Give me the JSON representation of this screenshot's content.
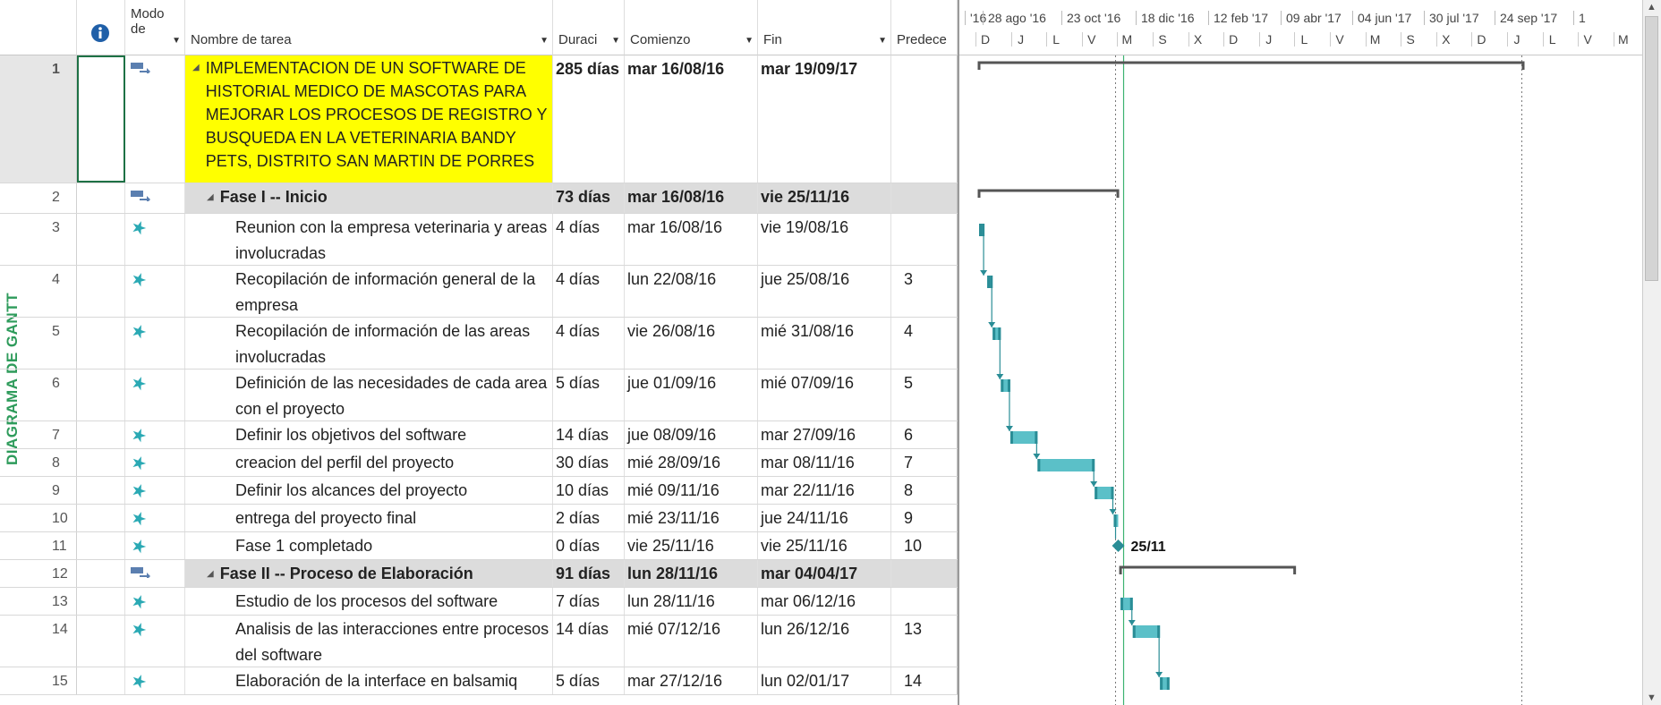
{
  "side_label": "DIAGRAMA DE GANTT",
  "headers": {
    "info_icon": "info-icon",
    "mode": "Modo de",
    "name": "Nombre de tarea",
    "duration": "Duraci",
    "start": "Comienzo",
    "end": "Fin",
    "pred": "Predece"
  },
  "timescale": {
    "top": [
      "'16",
      "28 ago '16",
      "23 oct '16",
      "18 dic '16",
      "12 feb '17",
      "09 abr '17",
      "04 jun '17",
      "30 jul '17",
      "24 sep '17",
      "1"
    ],
    "bottom": [
      "D",
      "J",
      "L",
      "V",
      "M",
      "S",
      "X",
      "D",
      "J",
      "L",
      "V",
      "M",
      "S",
      "X",
      "D",
      "J",
      "L",
      "V",
      "M"
    ]
  },
  "rows": [
    {
      "num": "1",
      "mode": "summary",
      "name": "IMPLEMENTACION DE UN SOFTWARE DE HISTORIAL MEDICO DE MASCOTAS PARA MEJORAR LOS PROCESOS DE REGISTRO Y BUSQUEDA EN LA VETERINARIA BANDY PETS, DISTRITO SAN MARTIN DE PORRES",
      "duration": "285 días",
      "start": "mar 16/08/16",
      "end": "mar 19/09/17",
      "pred": ""
    },
    {
      "num": "2",
      "mode": "summary",
      "name": "Fase I -- Inicio",
      "duration": "73 días",
      "start": "mar 16/08/16",
      "end": "vie 25/11/16",
      "pred": ""
    },
    {
      "num": "3",
      "mode": "manual",
      "name": "Reunion con la empresa veterinaria y areas involucradas",
      "duration": "4 días",
      "start": "mar 16/08/16",
      "end": "vie 19/08/16",
      "pred": ""
    },
    {
      "num": "4",
      "mode": "manual",
      "name": "Recopilación de información general de la empresa",
      "duration": "4 días",
      "start": "lun 22/08/16",
      "end": "jue 25/08/16",
      "pred": "3"
    },
    {
      "num": "5",
      "mode": "manual",
      "name": "Recopilación de información de las areas involucradas",
      "duration": "4 días",
      "start": "vie 26/08/16",
      "end": "mié 31/08/16",
      "pred": "4"
    },
    {
      "num": "6",
      "mode": "manual",
      "name": "Definición de las necesidades de cada area con el proyecto",
      "duration": "5 días",
      "start": "jue 01/09/16",
      "end": "mié 07/09/16",
      "pred": "5"
    },
    {
      "num": "7",
      "mode": "manual",
      "name": "Definir los objetivos del software",
      "duration": "14 días",
      "start": "jue 08/09/16",
      "end": "mar 27/09/16",
      "pred": "6"
    },
    {
      "num": "8",
      "mode": "manual",
      "name": "creacion del perfil del proyecto",
      "duration": "30 días",
      "start": "mié 28/09/16",
      "end": "mar 08/11/16",
      "pred": "7"
    },
    {
      "num": "9",
      "mode": "manual",
      "name": "Definir los alcances del proyecto",
      "duration": "10 días",
      "start": "mié 09/11/16",
      "end": "mar 22/11/16",
      "pred": "8"
    },
    {
      "num": "10",
      "mode": "manual",
      "name": "entrega del proyecto final",
      "duration": "2 días",
      "start": "mié 23/11/16",
      "end": "jue 24/11/16",
      "pred": "9"
    },
    {
      "num": "11",
      "mode": "manual",
      "name": "Fase 1 completado",
      "duration": "0 días",
      "start": "vie 25/11/16",
      "end": "vie 25/11/16",
      "pred": "10"
    },
    {
      "num": "12",
      "mode": "summary",
      "name": "Fase II -- Proceso de Elaboración",
      "duration": "91 días",
      "start": "lun 28/11/16",
      "end": "mar 04/04/17",
      "pred": ""
    },
    {
      "num": "13",
      "mode": "manual",
      "name": "Estudio de los procesos del software",
      "duration": "7 días",
      "start": "lun 28/11/16",
      "end": "mar 06/12/16",
      "pred": ""
    },
    {
      "num": "14",
      "mode": "manual",
      "name": "Analisis de las interacciones entre procesos del software",
      "duration": "14 días",
      "start": "mié 07/12/16",
      "end": "lun 26/12/16",
      "pred": "13"
    },
    {
      "num": "15",
      "mode": "manual",
      "name": "Elaboración de la interface en balsamiq",
      "duration": "5 días",
      "start": "mar 27/12/16",
      "end": "lun 02/01/17",
      "pred": "14"
    }
  ],
  "milestone_label": "25/11",
  "colors": {
    "task_bar": "#5bc0c8",
    "task_bar_dark": "#2a8d96",
    "summary_bar": "#555555",
    "highlight": "#ffff00",
    "summary_row": "#dcdcdc",
    "today_line": "#3cb371"
  }
}
